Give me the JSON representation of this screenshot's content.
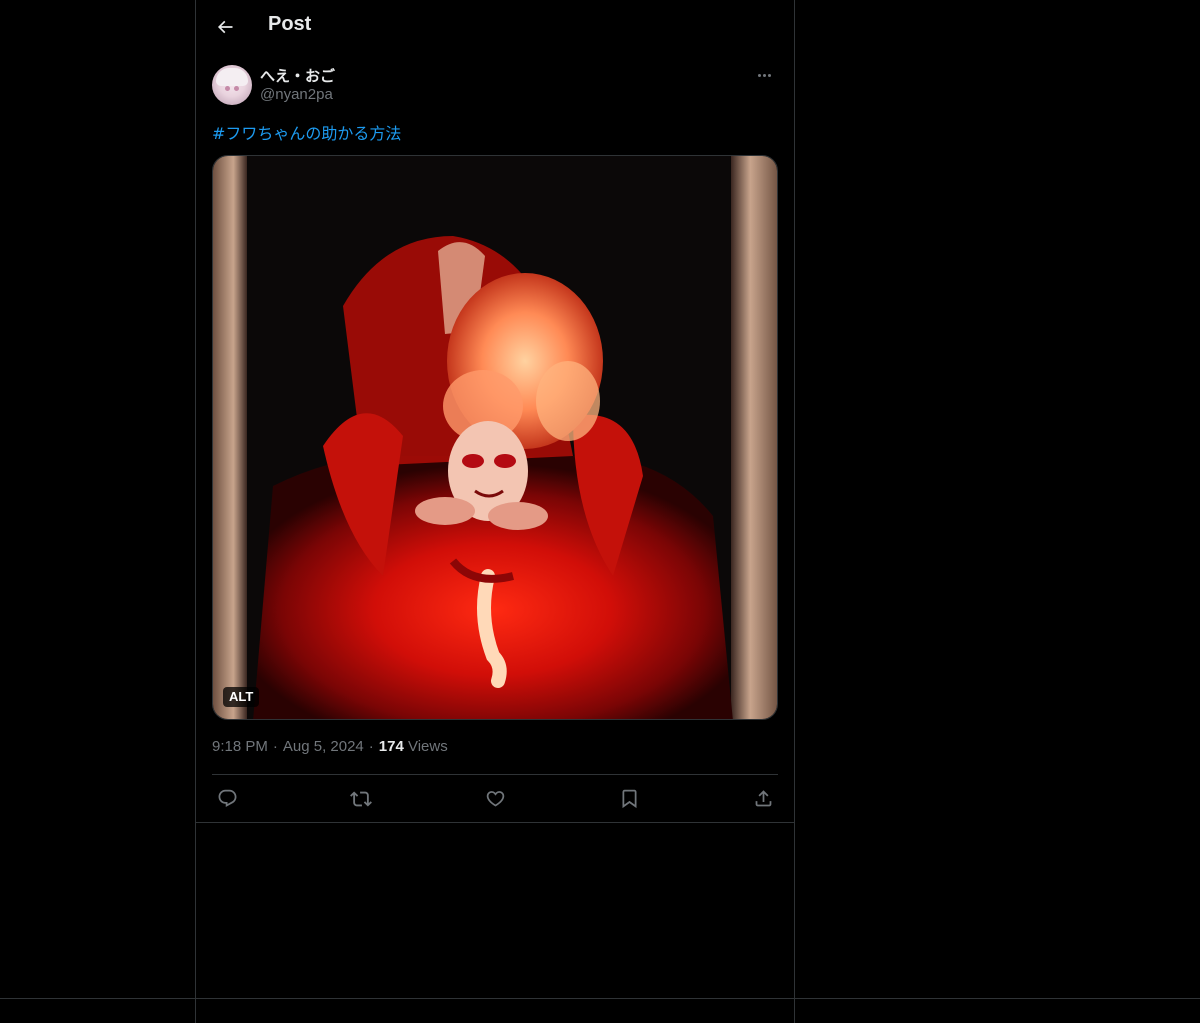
{
  "header": {
    "title": "Post",
    "back_icon": "arrow-left-icon"
  },
  "post": {
    "author": {
      "display_name": "へえ・おご",
      "handle": "@nyan2pa",
      "avatar_icon": "avatar-image"
    },
    "text": "#フワちゃんの助かる方法",
    "media": {
      "alt_badge": "ALT",
      "description_icon": "video-thumbnail"
    },
    "meta": {
      "time": "9:18 PM",
      "separator": "·",
      "date": "Aug 5, 2024",
      "views_count": "174",
      "views_label": "Views"
    },
    "actions": [
      {
        "name": "reply",
        "icon": "reply-icon"
      },
      {
        "name": "repost",
        "icon": "repost-icon"
      },
      {
        "name": "like",
        "icon": "heart-icon"
      },
      {
        "name": "bookmark",
        "icon": "bookmark-icon"
      },
      {
        "name": "share",
        "icon": "share-icon"
      }
    ]
  },
  "colors": {
    "background": "#000000",
    "text_primary": "#e7e9ea",
    "text_secondary": "#71767b",
    "link": "#1d9bf0",
    "border": "#2f3336"
  }
}
